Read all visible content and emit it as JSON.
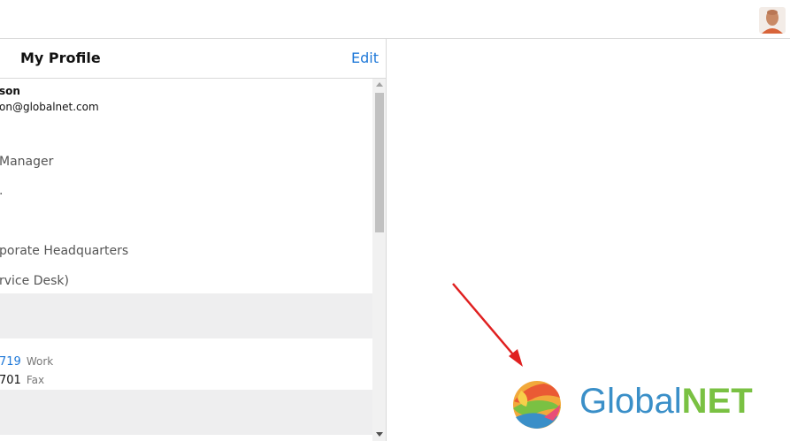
{
  "header": {
    "avatar_icon": "user-avatar-icon"
  },
  "profile": {
    "title": "My Profile",
    "edit_label": "Edit",
    "name": "son",
    "email": "on@globalnet.com",
    "job_title": "Manager",
    "department": ".",
    "location": "porate Headquarters",
    "team": "rvice Desk)",
    "phones": [
      {
        "number": "719",
        "type": "Work",
        "color": "#1e78d8"
      },
      {
        "number": "701",
        "type": "Fax",
        "color": "#111111"
      }
    ]
  },
  "logo": {
    "part1": "Global",
    "part2": "NET",
    "color_global": "#3a8fc8",
    "color_net": "#7ac143"
  },
  "colors": {
    "accent": "#1e78d8",
    "annotation": "#e02020"
  }
}
